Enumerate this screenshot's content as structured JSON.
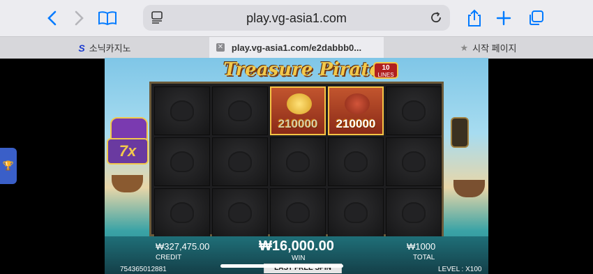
{
  "browser": {
    "url": "play.vg-asia1.com",
    "icons": [
      "back-icon",
      "forward-icon",
      "bookmarks-icon",
      "reader-icon",
      "reload-icon",
      "share-icon",
      "new-tab-icon",
      "tabs-icon"
    ]
  },
  "tabs": [
    {
      "label": "소닉카지노",
      "icon": "s-logo-icon",
      "active": false
    },
    {
      "label": "play.vg-asia1.com/e2dabbb0...",
      "icon": "close-icon",
      "active": true
    },
    {
      "label": "시작 페이지",
      "icon": "star-icon",
      "active": false
    }
  ],
  "game": {
    "title": "Treasure Pirate",
    "lines_number": "10",
    "lines_label": "LINES",
    "multiplier": "7x",
    "prizes": [
      "210000",
      "210000"
    ],
    "credit_amount": "₩327,475.00",
    "credit_label": "CREDIT",
    "win_amount": "₩16,000.00",
    "win_label": "WIN",
    "total_amount": "₩1000",
    "total_label": "TOTAL",
    "ticket_id": "754365012881",
    "free_spin_label": "LAST FREE SPIN",
    "level_label": "LEVEL : X100"
  },
  "colors": {
    "accent": "#007aff",
    "gold": "#f2c94c",
    "panel": "#1f6f78"
  }
}
